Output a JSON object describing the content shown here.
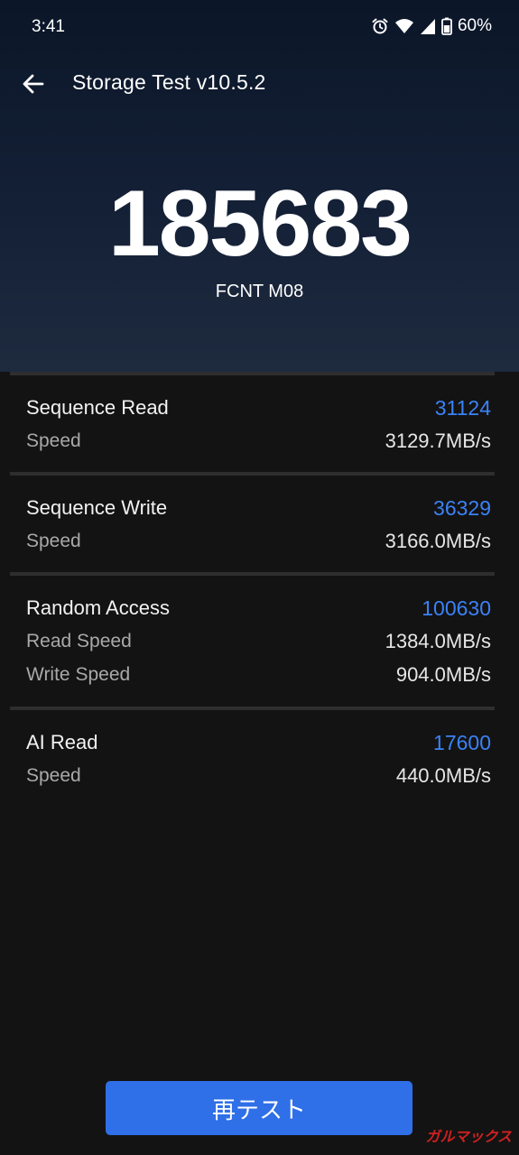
{
  "status_bar": {
    "time": "3:41",
    "battery": "60%",
    "icons": [
      "alarm-icon",
      "wifi-icon",
      "signal-icon",
      "battery-icon"
    ]
  },
  "app_bar": {
    "title": "Storage Test v10.5.2",
    "back_icon": "arrow-left-icon"
  },
  "result": {
    "score": "185683",
    "device": "FCNT M08"
  },
  "sections": [
    {
      "title": "Sequence Read",
      "score": "31124",
      "rows": [
        {
          "label": "Speed",
          "value": "3129.7MB/s"
        }
      ]
    },
    {
      "title": "Sequence Write",
      "score": "36329",
      "rows": [
        {
          "label": "Speed",
          "value": "3166.0MB/s"
        }
      ]
    },
    {
      "title": "Random Access",
      "score": "100630",
      "rows": [
        {
          "label": "Read Speed",
          "value": "1384.0MB/s"
        },
        {
          "label": "Write Speed",
          "value": "904.0MB/s"
        }
      ]
    },
    {
      "title": "AI Read",
      "score": "17600",
      "rows": [
        {
          "label": "Speed",
          "value": "440.0MB/s"
        }
      ]
    }
  ],
  "retest_button": {
    "label": "再テスト"
  },
  "watermark": "ガルマックス",
  "colors": {
    "accent_blue": "#3b82f6",
    "button_blue": "#2f6fe8",
    "background": "#131313",
    "hero_top": "#0b1628",
    "watermark_red": "#d02020"
  }
}
